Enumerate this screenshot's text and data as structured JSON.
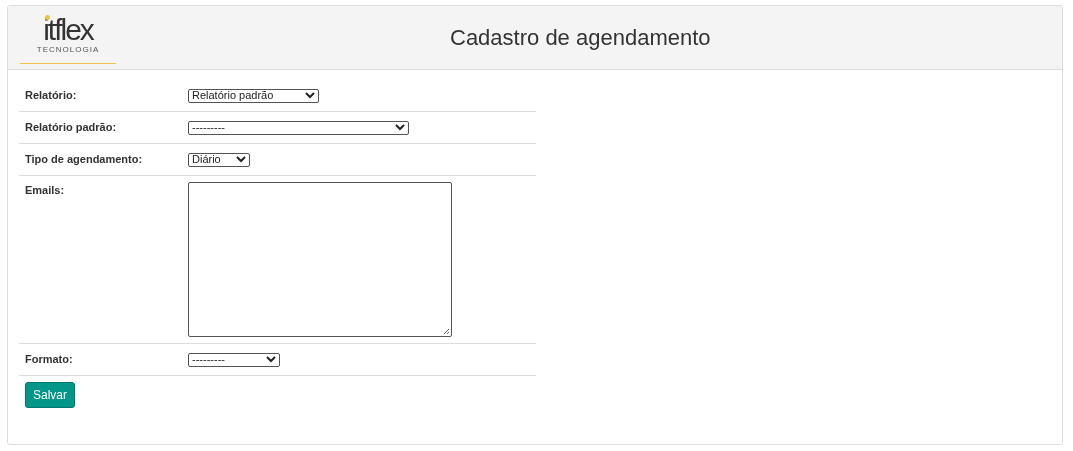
{
  "logo": {
    "name": "itflex",
    "tagline": "TECNOLOGIA"
  },
  "title": "Cadastro de agendamento",
  "fields": [
    {
      "label": "Relatório:",
      "kind": "select",
      "value": "Relatório padrão"
    },
    {
      "label": "Relatório padrão:",
      "kind": "select",
      "value": "---------"
    },
    {
      "label": "Tipo de agendamento:",
      "kind": "select",
      "value": "Diário"
    },
    {
      "label": "Emails:",
      "kind": "textarea"
    },
    {
      "label": "Formato:",
      "kind": "select",
      "value": "---------"
    }
  ],
  "save_button": "Salvar"
}
